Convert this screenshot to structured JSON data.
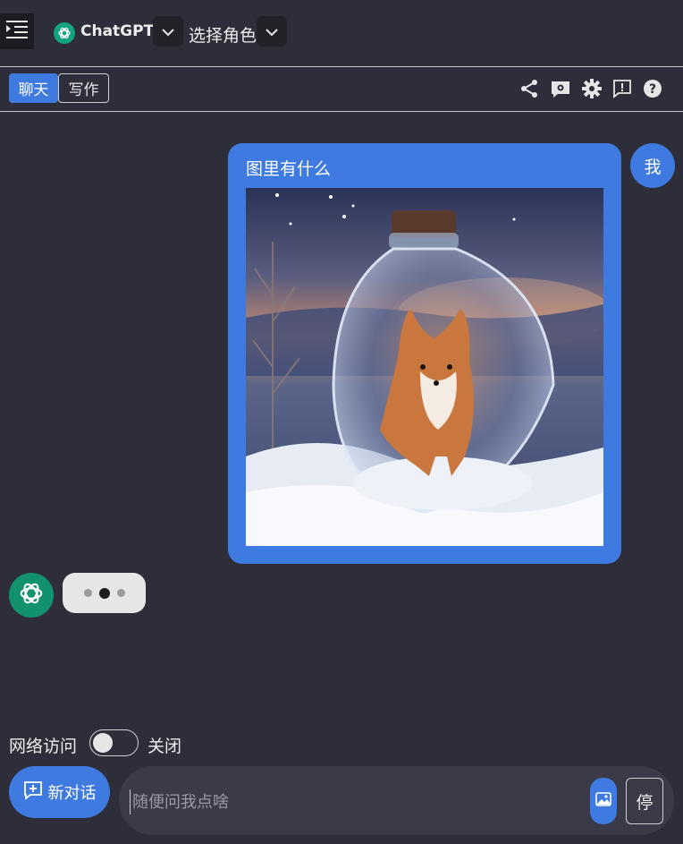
{
  "header": {
    "model_name": "ChatGPT",
    "role_label": "选择角色"
  },
  "tabs": [
    {
      "label": "聊天",
      "active": true
    },
    {
      "label": "写作",
      "active": false
    }
  ],
  "toolbar": {
    "icons": [
      "share-icon",
      "gpt-settings-icon",
      "gear-icon",
      "feedback-icon",
      "help-icon"
    ]
  },
  "messages": [
    {
      "role": "user",
      "avatar_label": "我",
      "text": "图里有什么",
      "has_image": true
    },
    {
      "role": "assistant",
      "status": "typing"
    }
  ],
  "network": {
    "label": "网络访问",
    "state_label": "关闭",
    "enabled": false
  },
  "composer": {
    "new_chat_label": "新对话",
    "placeholder": "随便问我点啥",
    "value": "",
    "stop_label": "停"
  },
  "colors": {
    "background": "#2e2e3a",
    "accent": "#3f7ae0",
    "assistant_avatar": "#12916f"
  }
}
